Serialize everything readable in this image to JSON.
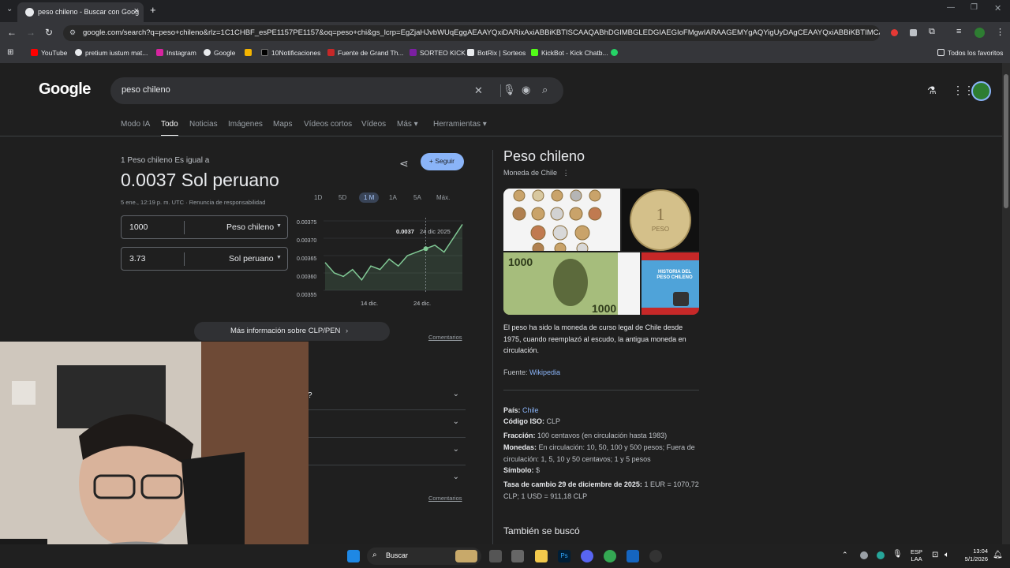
{
  "browser": {
    "tab_title": "peso chileno - Buscar con Goog",
    "url": "google.com/search?q=peso+chileno&rlz=1C1CHBF_esPE1157PE1157&oq=peso+chi&gs_lcrp=EgZjaHJvbWUqEggAEAAYQxiDARixAxiABBiKBTISCAAQABhDGIMBGLEDGIAEGIoFMgwIARAAGEMYgAQYigUyDAgCEAAYQxiABBiKBTIMCAMQA...",
    "bookmarks": [
      "YouTube",
      "pretium iustum mat...",
      "Instagram",
      "Google",
      "",
      "10Notificaciones",
      "Fuente de Grand Th...",
      "SORTEO KICK",
      "BotRix | Sorteos",
      "KickBot - Kick Chatb...",
      ""
    ],
    "all_bookmarks": "Todos los favoritos"
  },
  "search": {
    "logo": "Google",
    "query": "peso chileno",
    "tabs": [
      "Modo IA",
      "Todo",
      "Noticias",
      "Imágenes",
      "Maps",
      "Vídeos cortos",
      "Vídeos",
      "Más",
      "Herramientas"
    ]
  },
  "converter": {
    "equals": "1 Peso chileno Es igual a",
    "result": "0.0037 Sol peruano",
    "timestamp": "5 ene., 12:19 p. m. UTC · Renuncia de responsabilidad",
    "from_value": "1000",
    "from_currency": "Peso chileno",
    "to_value": "3.73",
    "to_currency": "Sol peruano",
    "follow": "Seguir",
    "ranges": [
      "1D",
      "5D",
      "1 M",
      "1A",
      "5A",
      "Máx."
    ],
    "more_info": "Más información sobre CLP/PEN",
    "feedback": "Comentarios",
    "feedback2": "Comentarios",
    "faq_partial": "?"
  },
  "chart_data": {
    "type": "line",
    "x": [
      "2025-12-05",
      "2025-12-07",
      "2025-12-09",
      "2025-12-11",
      "2025-12-13",
      "2025-12-15",
      "2025-12-17",
      "2025-12-19",
      "2025-12-21",
      "2025-12-23",
      "2025-12-25",
      "2025-12-27",
      "2025-12-29",
      "2025-12-31",
      "2026-01-02",
      "2026-01-04"
    ],
    "y": [
      0.00363,
      0.0036,
      0.00359,
      0.00361,
      0.00358,
      0.00362,
      0.00361,
      0.00364,
      0.00362,
      0.00365,
      0.00366,
      0.00367,
      0.00368,
      0.00366,
      0.0037,
      0.00374
    ],
    "yticks": [
      "0.00375",
      "0.00370",
      "0.00365",
      "0.00360",
      "0.00355"
    ],
    "ylim": [
      0.00355,
      0.00375
    ],
    "xticks": [
      "14 dic.",
      "24 dic."
    ],
    "tooltip_value": "0.0037",
    "tooltip_date": "24 dic 2025"
  },
  "knowledge": {
    "title": "Peso chileno",
    "subtitle": "Moneda de Chile",
    "description": "El peso  ha sido la moneda de curso legal de Chile desde 1975, cuando reemplazó al escudo, la antigua moneda en circulación.",
    "source_label": "Fuente:",
    "source": "Wikipedia",
    "facts": [
      {
        "k": "País:",
        "v": "Chile",
        "link": true
      },
      {
        "k": "Código ISO:",
        "v": "CLP"
      },
      {
        "k": "Fracción:",
        "v": "100 centavos (en circulación hasta 1983)"
      },
      {
        "k": "Monedas:",
        "v": "En circulación: 10, 50, 100 y 500 pesos; Fuera de circulación: 1, 5, 10 y 50 centavos; 1 y 5 pesos"
      },
      {
        "k": "Símbolo:",
        "v": "$"
      },
      {
        "k": "Tasa de cambio 29 de diciembre de 2025:",
        "v": "1 EUR = 1070,72 CLP; 1 USD = 911,18 CLP"
      }
    ],
    "also": "También se buscó",
    "coin_text": "1 PESO 1996",
    "bill_text": "1000",
    "video_label": "HISTORIA DEL PESO CHILENO"
  },
  "taskbar": {
    "search": "Buscar",
    "lang": "ESP",
    "lang2": "LAA",
    "time": "13:04",
    "date": "5/1/2026"
  },
  "colors": {
    "accent": "#8ab4f8",
    "chart_line": "#81c995",
    "bg": "#1f1f1f"
  }
}
